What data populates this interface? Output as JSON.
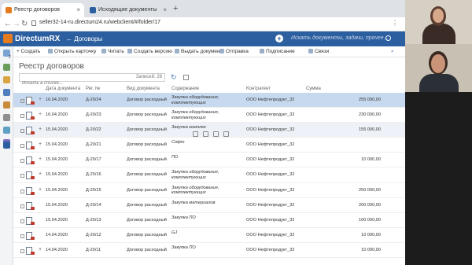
{
  "browser": {
    "tabs": [
      {
        "label": "Реестр договоров",
        "active": true,
        "color": "#e57a1f"
      },
      {
        "label": "Исходящие документы",
        "active": false,
        "color": "#2c5fa0"
      }
    ],
    "new_tab_glyph": "+",
    "url": "seller32-14-ru.directum24.ru/webclient/#/folder/17",
    "close_glyph": "×"
  },
  "app": {
    "name": "DirectumRX",
    "breadcrumb": "← Договоры",
    "search_placeholder": "Искать документы, задачи, прочее...",
    "accent": "#2c5fa0",
    "logo_color": "#e57a1f"
  },
  "rail": {
    "icons": [
      "notification-icon",
      "tasks-icon",
      "mail-icon",
      "documents-icon",
      "folder-icon",
      "user-icon",
      "clock-icon",
      "chart-icon",
      "apps-icon"
    ],
    "badge": "2"
  },
  "toolbar": {
    "items": [
      "+ Создать",
      "Открыть карточку",
      "Читать",
      "Создать версию",
      "Выдать документ",
      "Отправка",
      "Подписание",
      "Связи"
    ]
  },
  "page": {
    "title": "Реестр договоров",
    "search_placeholder": "Искать в списке...",
    "loaded_label": "Записей: 28"
  },
  "table": {
    "columns": [
      "Дата документа",
      "Рег. №",
      "Вид документа",
      "Содержание",
      "Контрагент",
      "Сумма"
    ],
    "rows": [
      {
        "date": "16.04.2020",
        "reg": "Д-20/24",
        "kind": "Договор расходный",
        "subject": "Закупка оборудования, комплектующих",
        "partner": "ООО Нефтепродукт_32",
        "sum": "255 000,00",
        "state": "selected",
        "expand": "+"
      },
      {
        "date": "16.04.2020",
        "reg": "Д-20/23",
        "kind": "Договор расходный",
        "subject": "Закупка оборудования, комплектующих",
        "partner": "ООО Нефтепродукт_32",
        "sum": "230 000,00",
        "state": "",
        "expand": "+"
      },
      {
        "date": "15.04.2020",
        "reg": "Д-20/22",
        "kind": "Договор расходный",
        "subject": "Закупка комплек",
        "partner": "ООО Нефтепродукт_32",
        "sum": "155 000,00",
        "state": "hover",
        "expand": "+"
      },
      {
        "date": "15.04.2020",
        "reg": "Д-20/21",
        "kind": "Договор расходный",
        "subject": "Софт",
        "partner": "ООО Нефтепродукт_32",
        "sum": "",
        "state": "",
        "expand": "+"
      },
      {
        "date": "15.04.2020",
        "reg": "Д-20/17",
        "kind": "Договор расходный",
        "subject": "ПО",
        "partner": "ООО Нефтепродукт_32",
        "sum": "10 000,00",
        "state": "",
        "expand": "+"
      },
      {
        "date": "15.04.2020",
        "reg": "Д-20/16",
        "kind": "Договор расходный",
        "subject": "Закупка оборудования, комплектующих",
        "partner": "ООО Нефтепродукт_32",
        "sum": "",
        "state": "",
        "expand": "+"
      },
      {
        "date": "15.04.2020",
        "reg": "Д-20/15",
        "kind": "Договор расходный",
        "subject": "Закупка оборудования, комплектующих",
        "partner": "ООО Нефтепродукт_32",
        "sum": "250 000,00",
        "state": "",
        "expand": "+"
      },
      {
        "date": "15.04.2020",
        "reg": "Д-20/14",
        "kind": "Договор расходный",
        "subject": "Закупка материалов",
        "partner": "ООО Нефтепродукт_32",
        "sum": "200 000,00",
        "state": "",
        "expand": ""
      },
      {
        "date": "15.04.2020",
        "reg": "Д-20/13",
        "kind": "Договор расходный",
        "subject": "Закупка ПО",
        "partner": "ООО Нефтепродукт_32",
        "sum": "100 000,00",
        "state": "",
        "expand": ""
      },
      {
        "date": "14.04.2020",
        "reg": "Д-20/12",
        "kind": "Договор расходный",
        "subject": "GJ",
        "partner": "ООО Нефтепродукт_32",
        "sum": "10 000,00",
        "state": "",
        "expand": ""
      },
      {
        "date": "14.04.2020",
        "reg": "Д-20/11",
        "kind": "Договор расходный",
        "subject": "Закупка ПО",
        "partner": "ООО Нефтепродукт_32",
        "sum": "10 000,00",
        "state": "",
        "expand": "+"
      }
    ]
  }
}
